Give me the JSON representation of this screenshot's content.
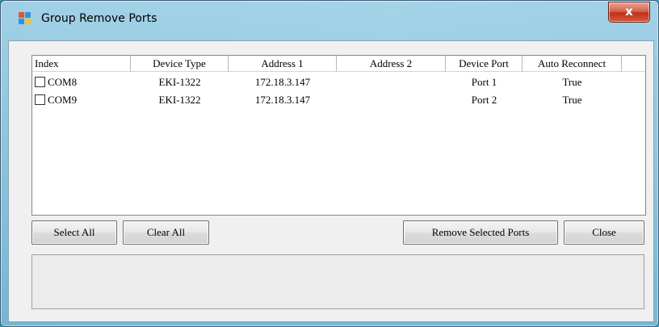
{
  "window": {
    "title": "Group Remove Ports",
    "close_glyph": "x"
  },
  "list": {
    "columns": [
      "Index",
      "Device Type",
      "Address 1",
      "Address 2",
      "Device Port",
      "Auto Reconnect"
    ],
    "rows": [
      {
        "index": "COM8",
        "device_type": "EKI-1322",
        "address1": "172.18.3.147",
        "address2": "",
        "device_port": "Port 1",
        "auto_reconnect": "True",
        "checked": false
      },
      {
        "index": "COM9",
        "device_type": "EKI-1322",
        "address1": "172.18.3.147",
        "address2": "",
        "device_port": "Port 2",
        "auto_reconnect": "True",
        "checked": false
      }
    ]
  },
  "buttons": {
    "select_all": "Select All",
    "clear_all": "Clear All",
    "remove_selected": "Remove Selected Ports",
    "close": "Close"
  },
  "icons": {
    "app": "app-window-icon",
    "close": "close-icon"
  },
  "colors": {
    "close_red": "#c1321a",
    "title_glass": "#8fc7de"
  }
}
